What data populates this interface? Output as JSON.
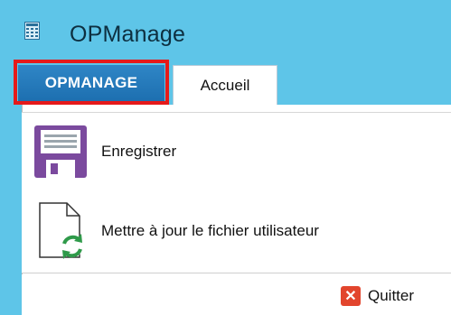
{
  "window": {
    "title": "OPManage",
    "icon": "spreadsheet-app-icon"
  },
  "ribbon": {
    "tabs": [
      {
        "label": "OPMANAGE",
        "selected": true,
        "highlighted": true
      },
      {
        "label": "Accueil",
        "selected": false
      }
    ]
  },
  "menu": {
    "items": [
      {
        "label": "Enregistrer",
        "icon": "floppy-disk-icon"
      },
      {
        "label": "Mettre à jour le fichier utilisateur",
        "icon": "document-refresh-icon"
      }
    ]
  },
  "footer": {
    "quit_label": "Quitter",
    "quit_icon": "close-icon"
  },
  "colors": {
    "titlebar": "#5ec5e8",
    "file_tab": "#1d6fb0",
    "highlight": "#e51a1a",
    "floppy": "#7b4a9e",
    "refresh": "#2f9a4a",
    "quit_icon": "#e2452d"
  }
}
